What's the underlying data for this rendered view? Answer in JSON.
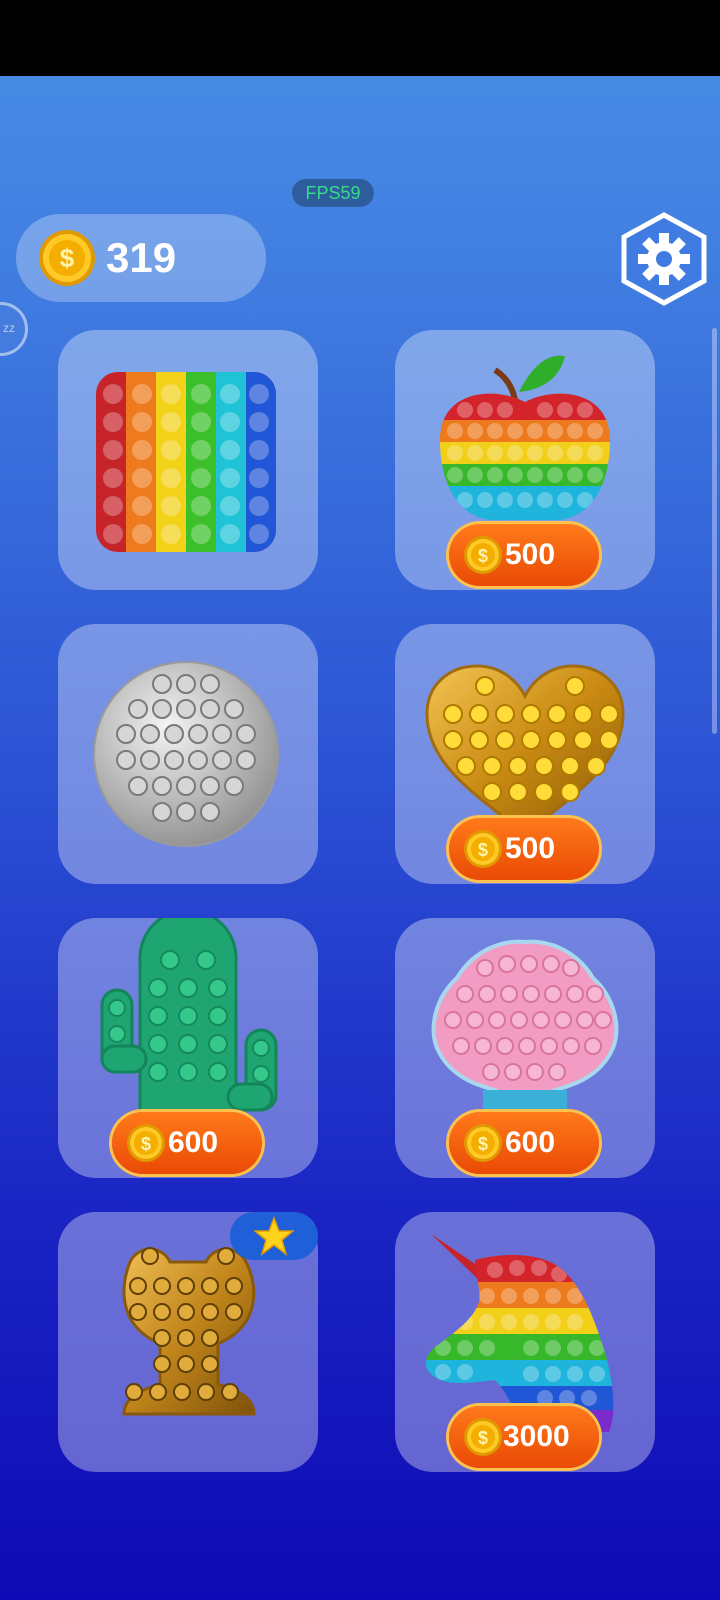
{
  "hud": {
    "fps": "FPS59",
    "coins": "319",
    "side_button_label": "zz"
  },
  "items": [
    {
      "name": "rainbow-square",
      "price": null
    },
    {
      "name": "rainbow-apple",
      "price": "500"
    },
    {
      "name": "silver-circle",
      "price": null
    },
    {
      "name": "gold-heart",
      "price": "500"
    },
    {
      "name": "green-cactus",
      "price": "600"
    },
    {
      "name": "pink-shell",
      "price": "600"
    },
    {
      "name": "gold-frog",
      "price": null,
      "featured": true
    },
    {
      "name": "rainbow-unicorn",
      "price": "3000"
    }
  ],
  "colors": {
    "price_pill": "#ea4a05",
    "coin": "#f5b400",
    "star_badge": "#1f5fd8"
  }
}
